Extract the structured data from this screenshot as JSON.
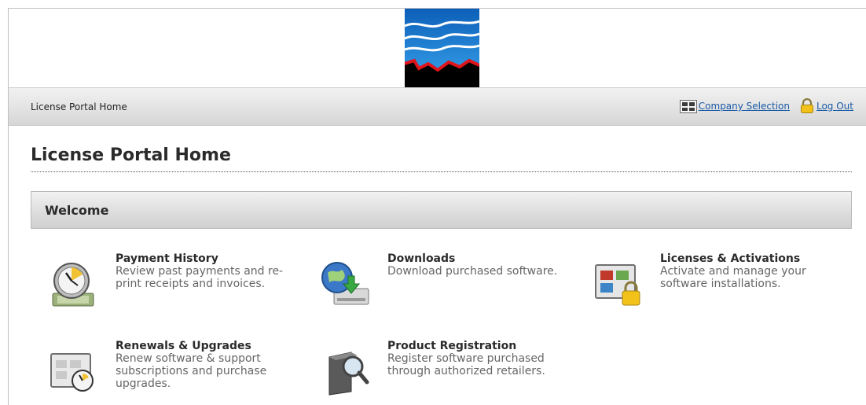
{
  "navbar": {
    "breadcrumb": "License Portal Home",
    "company_selection": "Company Selection",
    "log_out": "Log Out"
  },
  "page": {
    "title": "License Portal Home",
    "panel_title": "Welcome"
  },
  "tiles": [
    {
      "title": "Payment History",
      "description": "Review past payments and re-print receipts and invoices.",
      "icon": "clock-money-icon"
    },
    {
      "title": "Downloads",
      "description": "Download purchased software.",
      "icon": "globe-download-icon"
    },
    {
      "title": "Licenses & Activations",
      "description": "Activate and manage your software installations.",
      "icon": "window-lock-icon"
    },
    {
      "title": "Renewals & Upgrades",
      "description": "Renew software & support subscriptions and purchase upgrades.",
      "icon": "window-clock-icon"
    },
    {
      "title": "Product Registration",
      "description": "Register software purchased through authorized retailers.",
      "icon": "box-magnifier-icon"
    }
  ],
  "colors": {
    "link": "#1a5aa6",
    "logo_blue": "#1f7fd3",
    "logo_red": "#e0141b"
  }
}
